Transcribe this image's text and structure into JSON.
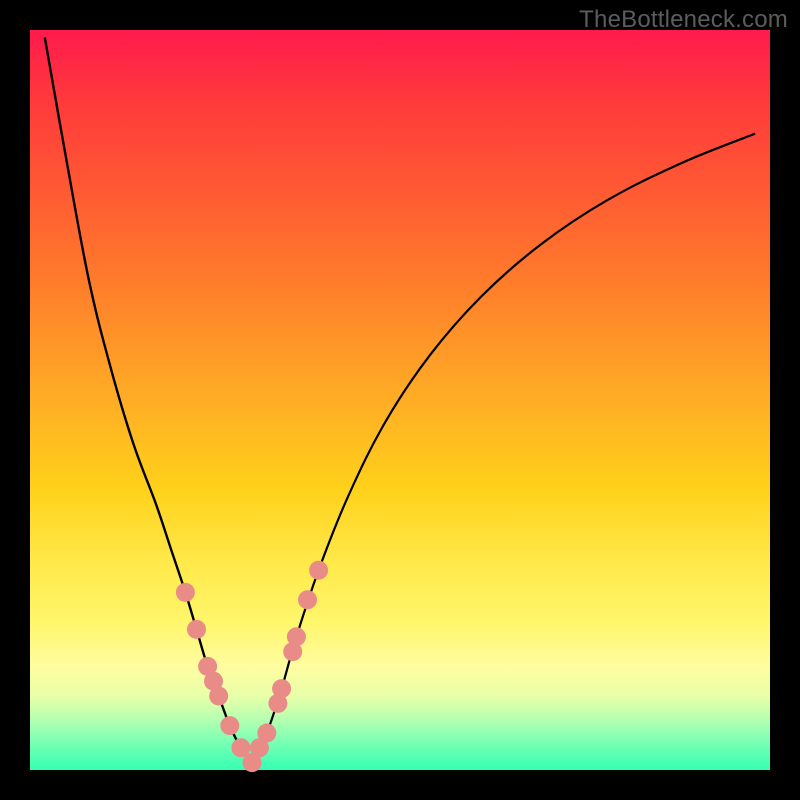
{
  "watermark": "TheBottleneck.com",
  "colors": {
    "frame": "#000000",
    "curve": "#000000",
    "marker_fill": "#e98b87",
    "marker_stroke": "#cf6e6b",
    "gradient_top": "#ff1a4d",
    "gradient_bottom": "#33ffb3"
  },
  "chart_data": {
    "type": "line",
    "title": "",
    "xlabel": "",
    "ylabel": "",
    "xlim": [
      0,
      100
    ],
    "ylim": [
      0,
      100
    ],
    "grid": false,
    "legend": false,
    "series": [
      {
        "name": "bottleneck-curve-left",
        "x": [
          2,
          5,
          8,
          11,
          14,
          17,
          19,
          21,
          22.5,
          24,
          25.5,
          27,
          28.5,
          30
        ],
        "values": [
          99,
          82,
          66,
          54,
          44,
          36,
          30,
          24,
          19,
          14,
          10,
          6,
          3,
          1
        ]
      },
      {
        "name": "bottleneck-curve-right",
        "x": [
          30,
          32,
          34,
          36,
          39,
          43,
          48,
          54,
          61,
          69,
          78,
          88,
          98
        ],
        "values": [
          1,
          5,
          11,
          18,
          27,
          37,
          47,
          56,
          64,
          71,
          77,
          82,
          86
        ]
      }
    ],
    "markers": [
      {
        "series": "bottleneck-curve-left",
        "x": 21.0,
        "y": 24
      },
      {
        "series": "bottleneck-curve-left",
        "x": 22.5,
        "y": 19
      },
      {
        "series": "bottleneck-curve-left",
        "x": 24.0,
        "y": 14
      },
      {
        "series": "bottleneck-curve-left",
        "x": 24.8,
        "y": 12
      },
      {
        "series": "bottleneck-curve-left",
        "x": 25.5,
        "y": 10
      },
      {
        "series": "bottleneck-curve-left",
        "x": 27.0,
        "y": 6
      },
      {
        "series": "bottleneck-curve-left",
        "x": 28.5,
        "y": 3
      },
      {
        "series": "bottleneck-curve-left",
        "x": 30.0,
        "y": 1
      },
      {
        "series": "bottleneck-curve-right",
        "x": 31.0,
        "y": 3
      },
      {
        "series": "bottleneck-curve-right",
        "x": 32.0,
        "y": 5
      },
      {
        "series": "bottleneck-curve-right",
        "x": 33.5,
        "y": 9
      },
      {
        "series": "bottleneck-curve-right",
        "x": 34.0,
        "y": 11
      },
      {
        "series": "bottleneck-curve-right",
        "x": 35.5,
        "y": 16
      },
      {
        "series": "bottleneck-curve-right",
        "x": 36.0,
        "y": 18
      },
      {
        "series": "bottleneck-curve-right",
        "x": 37.5,
        "y": 23
      },
      {
        "series": "bottleneck-curve-right",
        "x": 39.0,
        "y": 27
      }
    ]
  }
}
